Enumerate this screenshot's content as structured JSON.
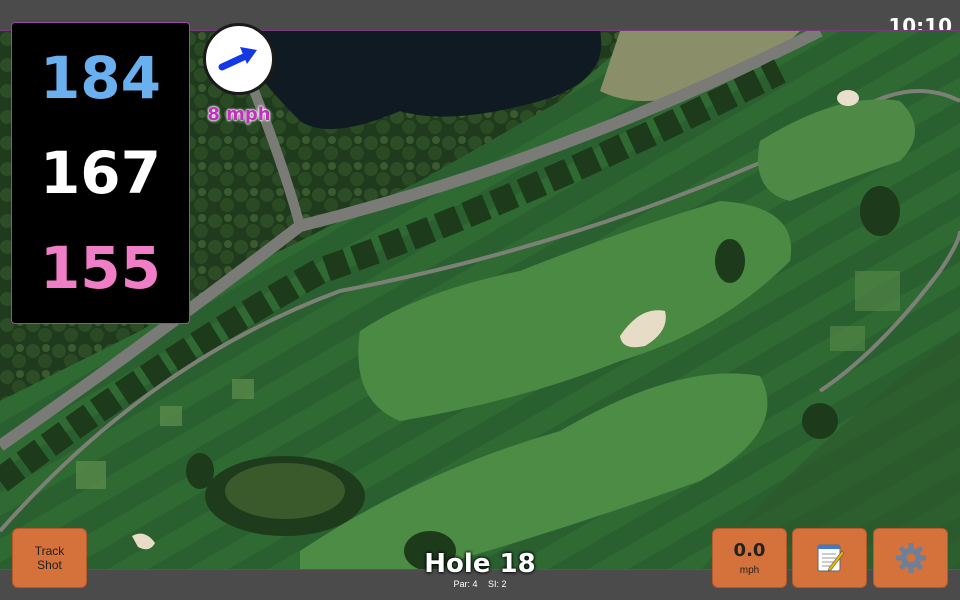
{
  "status": {
    "time": "10:10"
  },
  "yardages": {
    "back": "184",
    "middle": "167",
    "front": "155"
  },
  "wind": {
    "speed": "8 mph",
    "icon": "arrow-icon"
  },
  "buttons": {
    "track_shot": "Track Shot",
    "speed_value": "0.0",
    "speed_unit": "mph",
    "notes_icon": "notepad-icon",
    "settings_icon": "gear-icon"
  },
  "hole": {
    "title": "Hole 18",
    "par": "Par: 4",
    "si": "SI: 2"
  },
  "colors": {
    "back_yardage": "#6ab0ee",
    "middle_yardage": "#ffffff",
    "front_yardage": "#f07ec6",
    "button": "#d5713b",
    "wind_text": "#c02fbe"
  }
}
